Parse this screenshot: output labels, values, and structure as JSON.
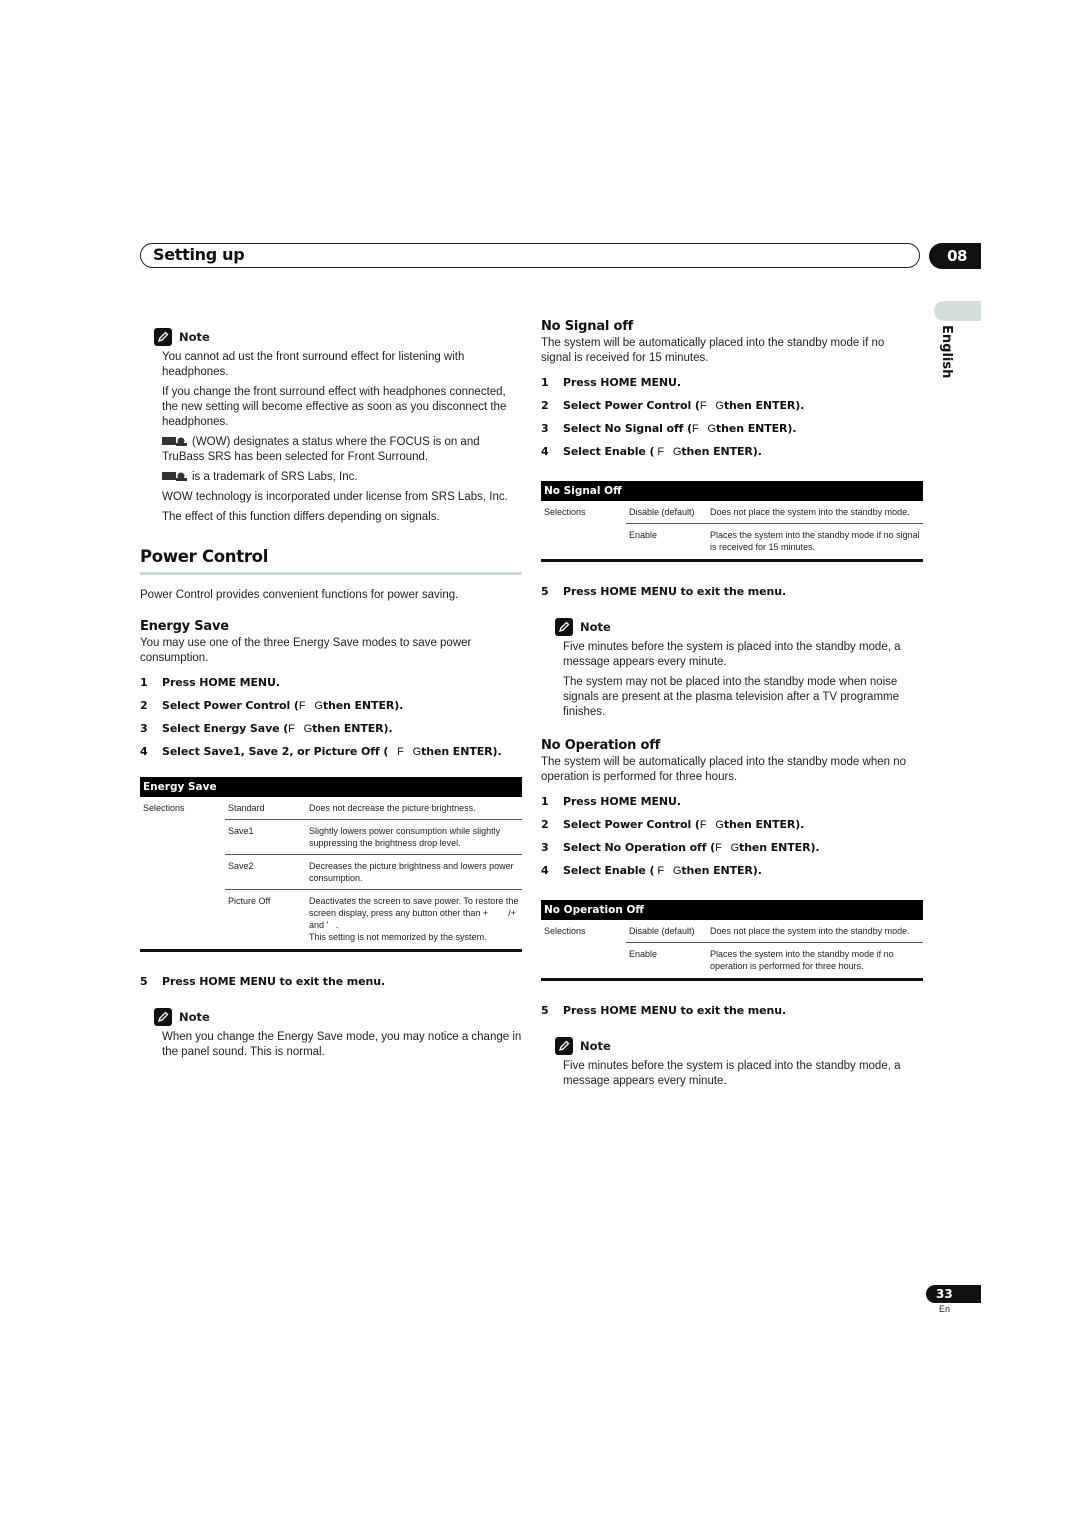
{
  "header": {
    "title": "Setting up",
    "chapter": "08"
  },
  "language_tab": "English",
  "left": {
    "note1": {
      "label": "Note",
      "paragraphs": [
        "You cannot ad ust the front surround effect for listening with headphones.",
        "If you change the front surround effect with headphones connected, the new setting will become effective as soon as you disconnect the headphones.",
        "(WOW) designates a status where the FOCUS is on and TruBass     SRS has been selected for Front Surround.",
        "is a trademark of SRS Labs, Inc.",
        "WOW technology is incorporated under license from SRS Labs, Inc.",
        "The effect of this function differs depending on signals."
      ]
    },
    "section_title": "Power Control",
    "section_intro": "Power Control provides convenient functions for power saving.",
    "energy_save": {
      "title": "Energy Save",
      "intro": "You may use one of the three Energy Save modes to save power consumption.",
      "steps": [
        {
          "num": "1",
          "text": "Press HOME MENU."
        },
        {
          "num": "2",
          "text": "Select Power Control (",
          "keys": "F   G",
          "tail": "then ENTER)."
        },
        {
          "num": "3",
          "text": "Select Energy Save (",
          "keys": "F   G",
          "tail": "then ENTER)."
        },
        {
          "num": "4",
          "text": "Select Save1, Save 2, or Picture Off (",
          "keys": "   F   G",
          "tail": "then ENTER)."
        }
      ],
      "table": {
        "title": "Energy Save",
        "rows": [
          {
            "c1": "Selections",
            "c2": "Standard",
            "c3": "Does not decrease the picture brightness."
          },
          {
            "c1": "",
            "c2": "Save1",
            "c3": "Slightly lowers power consumption while slightly suppressing the brightness drop level."
          },
          {
            "c1": "",
            "c2": "Save2",
            "c3": "Decreases the picture brightness and lowers power consumption."
          },
          {
            "c1": "",
            "c2": "Picture Off",
            "c3": "Deactivates the screen to save power. To restore the screen display, press any button other than +        /+        and '   .",
            "c3b": "This setting is not memorized by the system."
          }
        ]
      },
      "step5": {
        "num": "5",
        "text": "Press HOME MENU to exit the menu."
      },
      "note": {
        "label": "Note",
        "paragraphs": [
          "When you change the Energy Save mode, you may notice a change in the panel sound. This is normal."
        ]
      }
    }
  },
  "right": {
    "no_signal": {
      "title": "No Signal off",
      "intro": "The system will be automatically placed into the standby mode if no signal is received for 15 minutes.",
      "steps": [
        {
          "num": "1",
          "text": "Press HOME MENU."
        },
        {
          "num": "2",
          "text": "Select Power Control (",
          "keys": "F   G",
          "tail": "then ENTER)."
        },
        {
          "num": "3",
          "text": "Select No Signal off (",
          "keys": "F   G",
          "tail": "then ENTER)."
        },
        {
          "num": "4",
          "text": "Select Enable (",
          "keys": " F   G",
          "tail": "then ENTER)."
        }
      ],
      "table": {
        "title": "No Signal Off",
        "rows": [
          {
            "c1": "Selections",
            "c2": "Disable (default)",
            "c3": "Does not place the system into the standby mode."
          },
          {
            "c1": "",
            "c2": "Enable",
            "c3": "Places the system into the standby mode if no signal is received for 15 minutes."
          }
        ]
      },
      "step5": {
        "num": "5",
        "text": "Press HOME MENU to exit the menu."
      },
      "note": {
        "label": "Note",
        "paragraphs": [
          "Five minutes before the system is placed into the standby mode, a message appears every minute.",
          "The system may not be placed into the standby mode when noise signals are present at the plasma television after a TV programme finishes."
        ]
      }
    },
    "no_operation": {
      "title": "No Operation off",
      "intro": "The system will be automatically placed into the standby mode when no operation is performed for three hours.",
      "steps": [
        {
          "num": "1",
          "text": "Press HOME MENU."
        },
        {
          "num": "2",
          "text": "Select Power Control (",
          "keys": "F   G",
          "tail": "then ENTER)."
        },
        {
          "num": "3",
          "text": "Select No Operation off (",
          "keys": "F   G",
          "tail": "then ENTER)."
        },
        {
          "num": "4",
          "text": "Select Enable (",
          "keys": " F   G",
          "tail": "then ENTER)."
        }
      ],
      "table": {
        "title": "No Operation Off",
        "rows": [
          {
            "c1": "Selections",
            "c2": "Disable (default)",
            "c3": "Does not place the system into the standby mode."
          },
          {
            "c1": "",
            "c2": "Enable",
            "c3": "Places the system into the standby mode if no operation is performed for three hours."
          }
        ]
      },
      "step5": {
        "num": "5",
        "text": "Press HOME MENU to exit the menu."
      },
      "note": {
        "label": "Note",
        "paragraphs": [
          "Five minutes before the system is placed into the standby mode, a message appears every minute."
        ]
      }
    }
  },
  "footer": {
    "page_number": "33",
    "language_code": "En"
  }
}
